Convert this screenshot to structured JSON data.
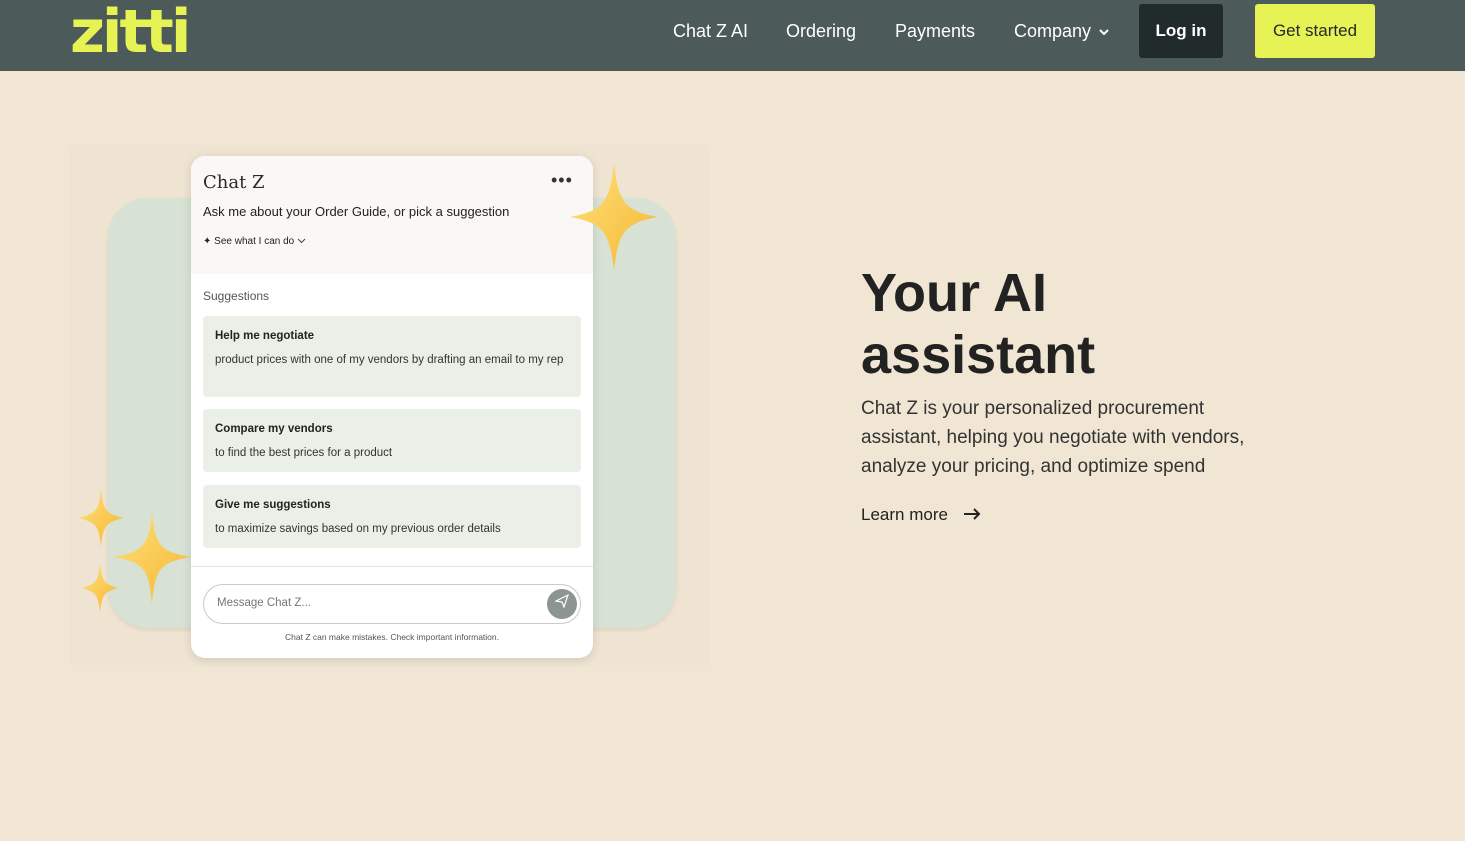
{
  "nav": {
    "logo": "zitti",
    "links": [
      {
        "label": "Chat Z AI"
      },
      {
        "label": "Ordering"
      },
      {
        "label": "Payments"
      },
      {
        "label": "Company"
      }
    ],
    "login_label": "Log in",
    "get_started_label": "Get started"
  },
  "chat": {
    "title": "Chat Z",
    "more": "•••",
    "subtitle": "Ask me about your Order Guide, or pick a suggestion",
    "see_what": "See what I can do",
    "suggestions_heading": "Suggestions",
    "suggestions": [
      {
        "title": "Help me negotiate",
        "desc": "product prices with one of my vendors by drafting an email to my rep"
      },
      {
        "title": "Compare my vendors",
        "desc": "to find the best prices for a product"
      },
      {
        "title": "Give me suggestions",
        "desc": "to maximize savings based on my previous order details"
      }
    ],
    "message_placeholder": "Message Chat Z...",
    "disclaimer": "Chat Z can make mistakes. Check important information."
  },
  "hero": {
    "title": "Your AI assistant",
    "description": "Chat Z is your personalized procurement assistant, helping you negotiate with vendors, analyze your pricing, and optimize spend",
    "learn_more": "Learn more"
  },
  "colors": {
    "nav_bg": "#4d5a5a",
    "accent": "#e7f254",
    "page_bg": "#f0e6d3",
    "card_green": "#d8e2d4"
  }
}
